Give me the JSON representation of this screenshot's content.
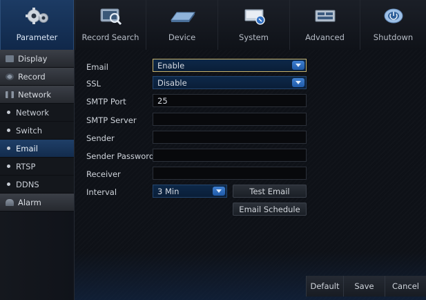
{
  "nav": {
    "tabs": [
      {
        "label": "Parameter",
        "icon": "gears-icon",
        "active": true
      },
      {
        "label": "Record Search",
        "icon": "record-search-icon",
        "active": false
      },
      {
        "label": "Device",
        "icon": "device-icon",
        "active": false
      },
      {
        "label": "System",
        "icon": "system-icon",
        "active": false
      },
      {
        "label": "Advanced",
        "icon": "advanced-icon",
        "active": false
      },
      {
        "label": "Shutdown",
        "icon": "shutdown-icon",
        "active": false
      }
    ]
  },
  "sidebar": {
    "items": [
      {
        "label": "Display",
        "type": "group"
      },
      {
        "label": "Record",
        "type": "group"
      },
      {
        "label": "Network",
        "type": "group"
      },
      {
        "label": "Network",
        "type": "sub"
      },
      {
        "label": "Switch",
        "type": "sub"
      },
      {
        "label": "Email",
        "type": "sub",
        "selected": true
      },
      {
        "label": "RTSP",
        "type": "sub"
      },
      {
        "label": "DDNS",
        "type": "sub"
      },
      {
        "label": "Alarm",
        "type": "group"
      }
    ]
  },
  "form": {
    "email": {
      "label": "Email",
      "value": "Enable"
    },
    "ssl": {
      "label": "SSL",
      "value": "Disable"
    },
    "smtp_port": {
      "label": "SMTP Port",
      "value": "25"
    },
    "smtp_server": {
      "label": "SMTP Server",
      "value": ""
    },
    "sender": {
      "label": "Sender",
      "value": ""
    },
    "sender_password": {
      "label": "Sender Password",
      "value": ""
    },
    "receiver": {
      "label": "Receiver",
      "value": ""
    },
    "interval": {
      "label": "Interval",
      "value": "3 Min"
    },
    "test_email_label": "Test Email",
    "email_schedule_label": "Email Schedule"
  },
  "footer": {
    "default_label": "Default",
    "save_label": "Save",
    "cancel_label": "Cancel"
  },
  "colors": {
    "accent": "#1f5aa8",
    "active_tab": "#1c3b64",
    "focus_border": "#c9b36a"
  }
}
